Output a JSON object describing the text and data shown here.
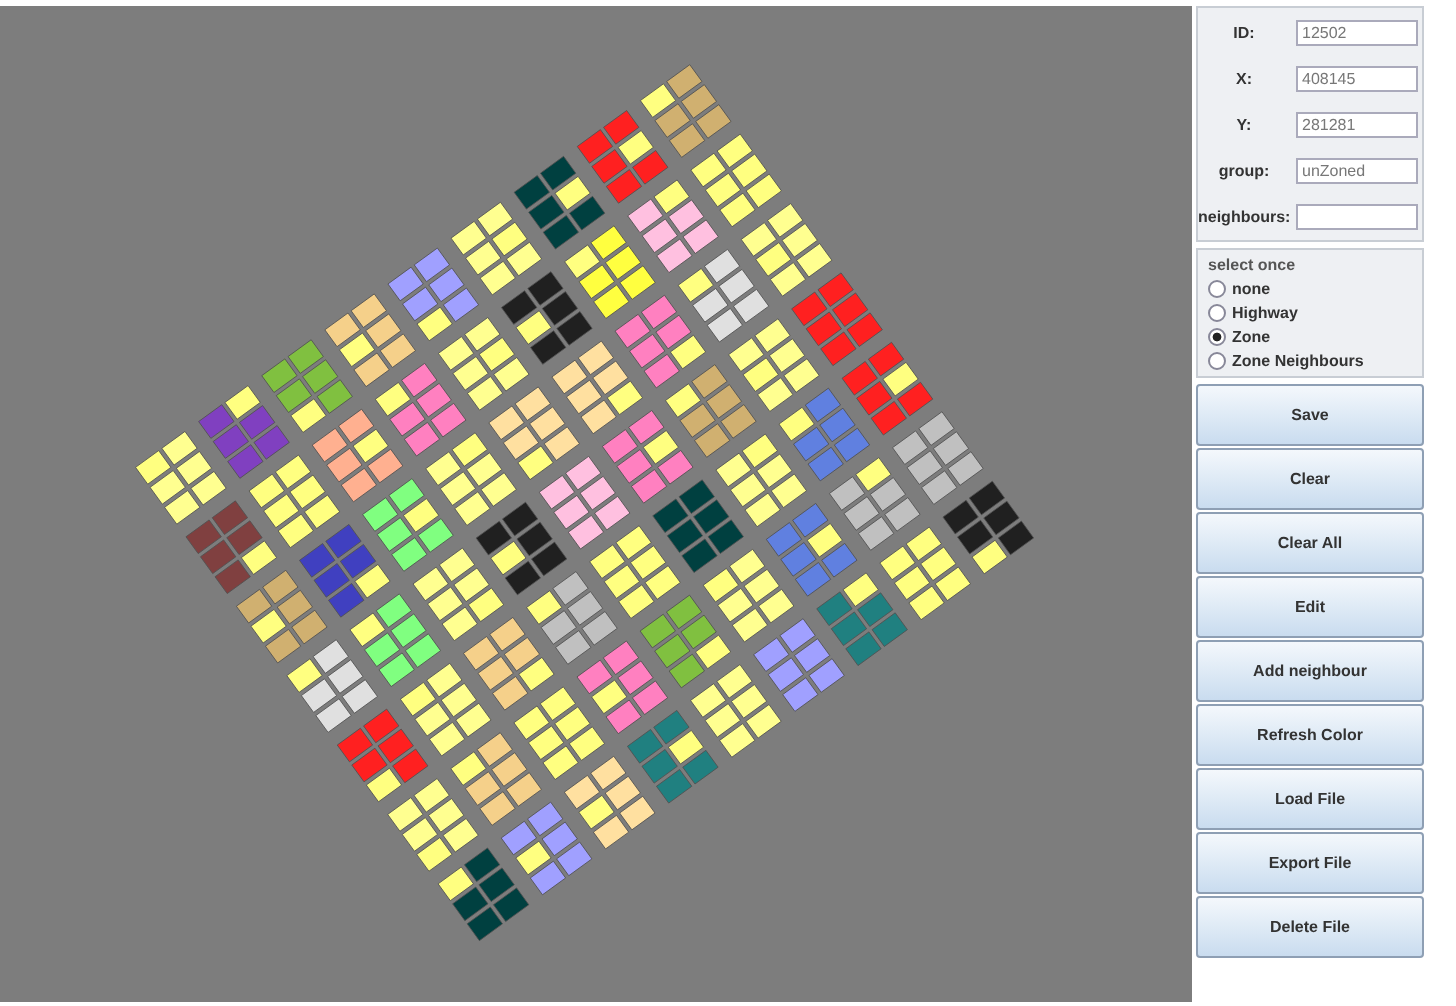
{
  "fields": [
    {
      "label": "ID:",
      "value": "12502"
    },
    {
      "label": "X:",
      "value": "408145"
    },
    {
      "label": "Y:",
      "value": "281281"
    },
    {
      "label": "group:",
      "value": "unZoned"
    },
    {
      "label": "neighbours:"
    }
  ],
  "mode_group": {
    "title": "select once",
    "options": [
      {
        "label": "none",
        "selected": false
      },
      {
        "label": "Highway",
        "selected": false
      },
      {
        "label": "Zone",
        "selected": true
      },
      {
        "label": "Zone Neighbours",
        "selected": false
      }
    ]
  },
  "buttons": [
    "Save",
    "Clear",
    "Clear All",
    "Edit",
    "Add neighbour",
    "Refresh Color",
    "Load File",
    "Export File",
    "Delete File"
  ]
}
